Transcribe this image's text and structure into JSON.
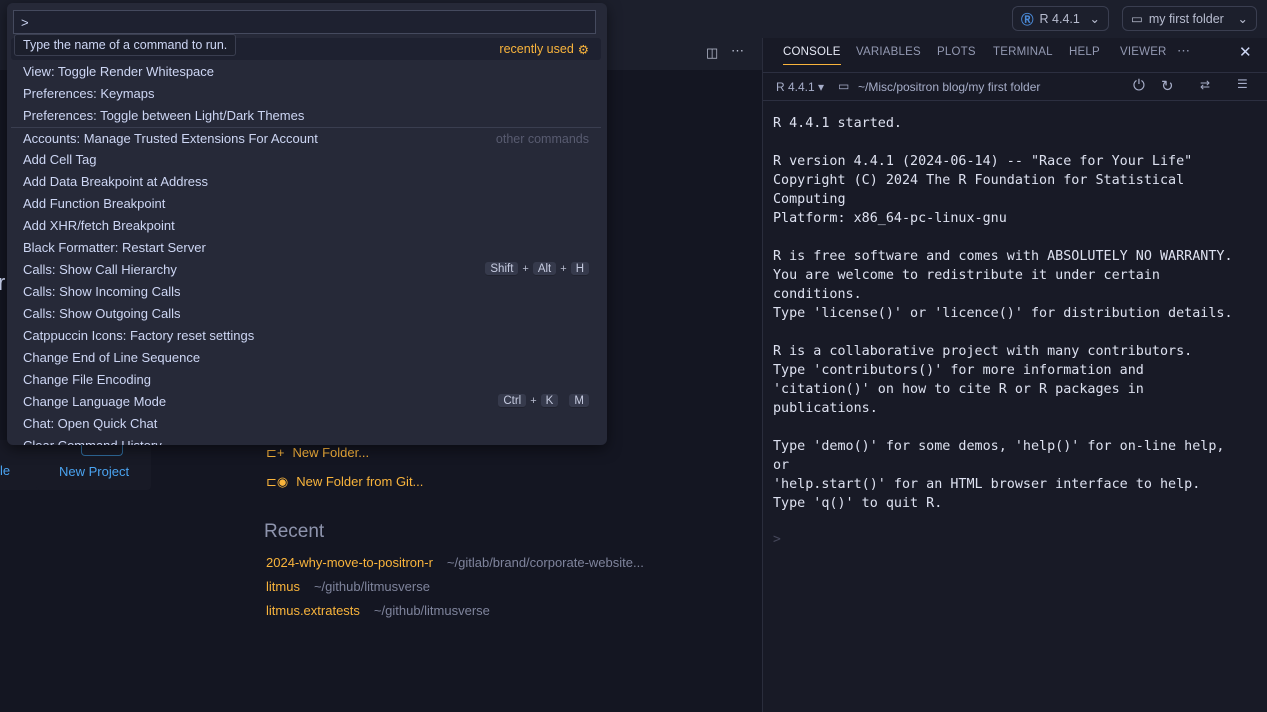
{
  "titlebar": {
    "interpreter": "R 4.4.1",
    "folder": "my first folder"
  },
  "command_palette": {
    "input_value": ">",
    "tooltip": "Type the name of a command to run.",
    "recent_label": "recently used",
    "other_label": "other commands",
    "items": [
      {
        "label": "View: Toggle Render Whitespace"
      },
      {
        "label": "Preferences: Keymaps"
      },
      {
        "label": "Preferences: Toggle between Light/Dark Themes"
      },
      {
        "label": "Accounts: Manage Trusted Extensions For Account"
      },
      {
        "label": "Add Cell Tag"
      },
      {
        "label": "Add Data Breakpoint at Address"
      },
      {
        "label": "Add Function Breakpoint"
      },
      {
        "label": "Add XHR/fetch Breakpoint"
      },
      {
        "label": "Black Formatter: Restart Server"
      },
      {
        "label": "Calls: Show Call Hierarchy",
        "keys": [
          "Shift",
          "Alt",
          "H"
        ]
      },
      {
        "label": "Calls: Show Incoming Calls"
      },
      {
        "label": "Calls: Show Outgoing Calls"
      },
      {
        "label": "Catppuccin Icons: Factory reset settings"
      },
      {
        "label": "Change End of Line Sequence"
      },
      {
        "label": "Change File Encoding"
      },
      {
        "label": "Change Language Mode",
        "keys": [
          "Ctrl",
          "K",
          "M"
        ]
      },
      {
        "label": "Chat: Open Quick Chat"
      },
      {
        "label": "Clear Command History"
      }
    ]
  },
  "welcome": {
    "partial_left": "le",
    "new_project": "New Project",
    "new_folder": "New Folder...",
    "new_folder_git": "New Folder from Git...",
    "recent_title": "Recent",
    "recent": [
      {
        "name": "2024-why-move-to-positron-r",
        "path": "~/gitlab/brand/corporate-website..."
      },
      {
        "name": "litmus",
        "path": "~/github/litmusverse"
      },
      {
        "name": "litmus.extratests",
        "path": "~/github/litmusverse"
      }
    ]
  },
  "panel": {
    "tabs": [
      "CONSOLE",
      "VARIABLES",
      "PLOTS",
      "TERMINAL",
      "HELP",
      "VIEWER"
    ],
    "active_tab": "CONSOLE",
    "session": "R 4.4.1",
    "path": "~/Misc/positron blog/my first folder",
    "console_lines": [
      "R 4.4.1 started.",
      "",
      "R version 4.4.1 (2024-06-14) -- \"Race for Your Life\"",
      "Copyright (C) 2024 The R Foundation for Statistical",
      "Computing",
      "Platform: x86_64-pc-linux-gnu",
      "",
      "R is free software and comes with ABSOLUTELY NO WARRANTY.",
      "You are welcome to redistribute it under certain",
      "conditions.",
      "Type 'license()' or 'licence()' for distribution details.",
      "",
      "R is a collaborative project with many contributors.",
      "Type 'contributors()' for more information and",
      "'citation()' on how to cite R or R packages in",
      "publications.",
      "",
      "Type 'demo()' for some demos, 'help()' for on-line help,",
      "or",
      "'help.start()' for an HTML browser interface to help.",
      "Type 'q()' to quit R."
    ],
    "prompt": ">"
  },
  "colors": {
    "accent": "#f9b43c",
    "link": "#4aa3f0"
  }
}
